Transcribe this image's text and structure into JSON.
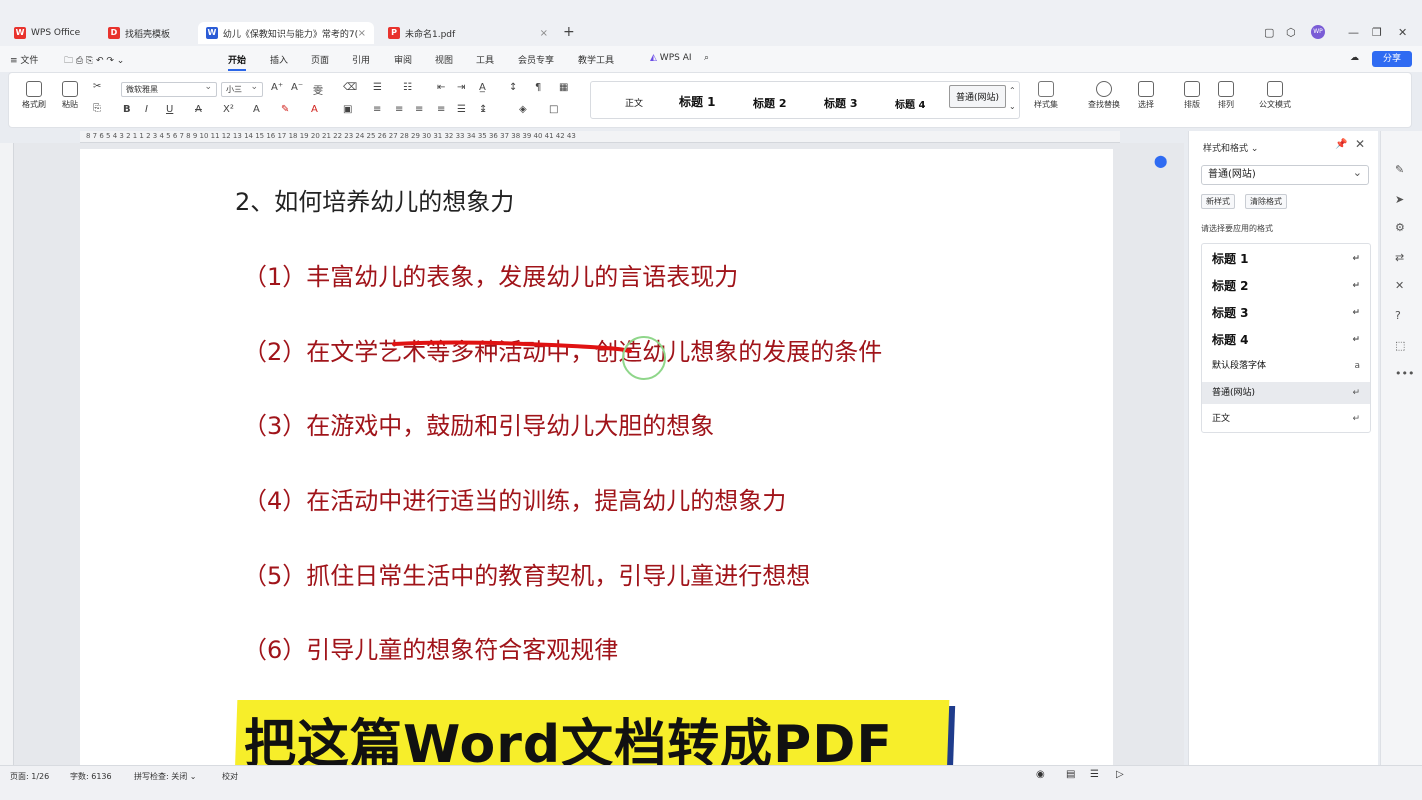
{
  "tabs": [
    {
      "label": "WPS Office",
      "icon": "wps-logo-icon",
      "color": "#e8332d"
    },
    {
      "label": "找稻壳模板",
      "icon": "docer-icon",
      "color": "#e8332d"
    },
    {
      "label": "幼儿《保教知识与能力》常考的7(",
      "icon": "word-doc-icon",
      "color": "#2b5cd6",
      "close": "×"
    },
    {
      "label": "未命名1.pdf",
      "icon": "pdf-icon",
      "color": "#e8332d",
      "close": "×"
    }
  ],
  "menu": {
    "file": "文件",
    "items": [
      "开始",
      "插入",
      "页面",
      "引用",
      "审阅",
      "视图",
      "工具",
      "会员专享",
      "教学工具"
    ],
    "wps_ai": "WPS AI",
    "share": "分享"
  },
  "ribbon": {
    "format_painter": "格式刷",
    "paste": "粘贴",
    "font_name": "微软雅黑",
    "font_size": "小三",
    "styles": [
      "正文",
      "标题 1",
      "标题 2",
      "标题 3",
      "标题 4",
      "普通(网站)"
    ],
    "style_set": "样式集",
    "find_replace": "查找替换",
    "select": "选择",
    "layout": "排版",
    "arrange": "排列",
    "official_mode": "公文模式"
  },
  "ruler_numbers": "8 7 6 5 4 3 2 1   1 2 3 4 5 6 7 8 9 10 11 12 13 14 15 16 17 18 19 20 21 22 23 24 25 26 27 28 29 30 31 32 33 34 35 36 37 38 39 40 41 42 43",
  "document": {
    "heading": "2、如何培养幼儿的想象力",
    "items": [
      "（1）丰富幼儿的表象，发展幼儿的言语表现力",
      "（2）在文学艺术等多种活动中，创造幼儿想象的发展的条件",
      "（3）在游戏中，鼓励和引导幼儿大胆的想象",
      "（4）在活动中进行适当的训练，提高幼儿的想象力",
      "（5）抓住日常生活中的教育契机，引导儿童进行想想",
      "（6）引导儿童的想象符合客观规律"
    ]
  },
  "banner": "把这篇Word文档转成PDF",
  "panel": {
    "title": "样式和格式",
    "current_style": "普通(网站)",
    "new_style": "新样式",
    "clear_format": "清除格式",
    "hint": "请选择要应用的格式",
    "styles": [
      "标题 1",
      "标题 2",
      "标题 3",
      "标题 4",
      "默认段落字体",
      "普通(网站)",
      "正文"
    ],
    "return_mark": "↵"
  },
  "status": {
    "page": "页面: 1/26",
    "words": "字数: 6136",
    "spell": "拼写检查: 关闭",
    "proof": "校对"
  }
}
